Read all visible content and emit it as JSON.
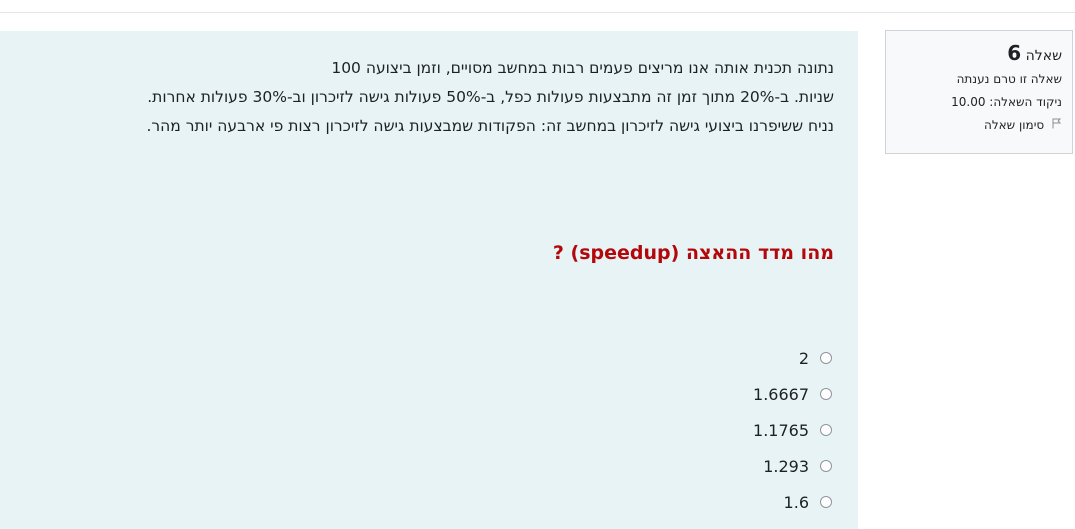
{
  "info": {
    "question_word": "שאלה",
    "question_number": "6",
    "status": "שאלה זו טרם נענתה",
    "score_label": "ניקוד השאלה: 10.00",
    "flag_label": "סימון שאלה"
  },
  "question": {
    "lines": [
      "נתונה תכנית אותה אנו מריצים פעמים רבות במחשב מסויים, וזמן ביצועה 100",
      "שניות. ב-20% מתוך זמן זה מתבצעות פעולות כפל, ב-50% פעולות גישה לזיכרון וב-30% פעולות אחרות.",
      "נניח ששיפרנו ביצועי גישה לזיכרון במחשב זה: הפקודות שמבצעות גישה לזיכרון רצות פי ארבעה יותר מהר."
    ],
    "ask": "מהו מדד ההאצה (speedup) ?"
  },
  "answers": [
    "2",
    "1.6667",
    "1.1765",
    "1.293",
    "1.6"
  ],
  "colors": {
    "content_bg": "#e7f3f5",
    "ask_color": "#b3080b",
    "info_bg": "#f8f9fa"
  }
}
